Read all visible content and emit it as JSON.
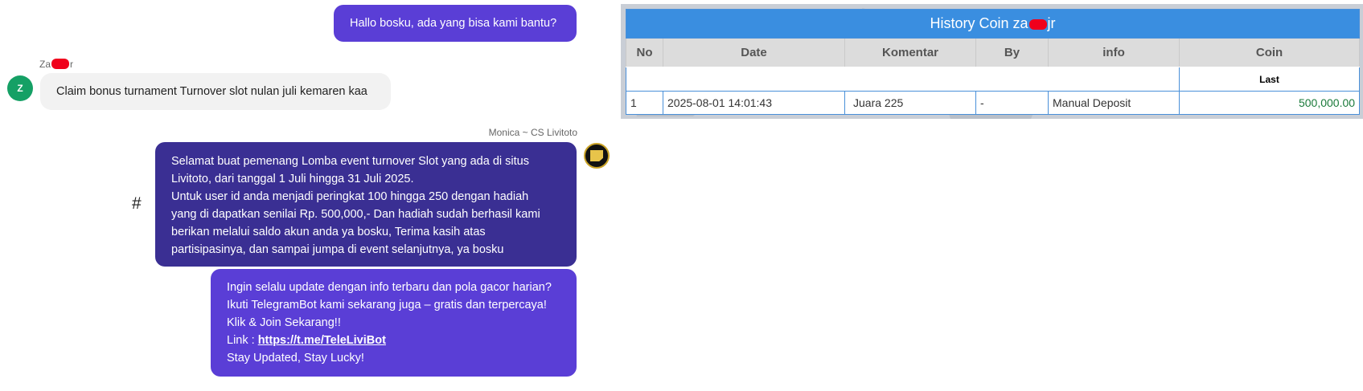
{
  "chat": {
    "greeting": "Hallo bosku, ada yang bisa kami bantu?",
    "user": {
      "name_prefix": "Za",
      "name_suffix": "r",
      "avatar_initial": "Z",
      "message": "Claim bonus turnament Turnover slot nulan juli kemaren kaa"
    },
    "agent": {
      "name": "Monica ~ CS Livitoto",
      "hash_symbol": "#",
      "message_lines": [
        "Selamat buat pemenang Lomba event turnover Slot yang ada di situs",
        "Livitoto, dari tanggal 1 Juli hingga 31 Juli 2025.",
        "Untuk user id anda menjadi peringkat 100 hingga 250 dengan hadiah",
        "yang di dapatkan senilai Rp. 500,000,- Dan hadiah sudah berhasil kami",
        "berikan melalui saldo akun anda ya bosku, Terima kasih atas",
        "partisipasinya, dan sampai jumpa di event selanjutnya, ya bosku"
      ]
    },
    "promo": {
      "line1": "Ingin selalu update dengan info terbaru dan pola gacor harian?",
      "line2": "Ikuti TelegramBot kami sekarang juga – gratis dan terpercaya!",
      "line3": "Klik & Join Sekarang!!",
      "link_label": "Link : ",
      "link_url": "https://t.me/TeleLiviBot",
      "line5": "Stay Updated, Stay Lucky!"
    }
  },
  "history": {
    "title_prefix": "History Coin za",
    "title_suffix": "jr",
    "columns": [
      "No",
      "Date",
      "Komentar",
      "By",
      "info",
      "Coin"
    ],
    "sub_label": "Last",
    "rows": [
      {
        "no": "1",
        "date": "2025-08-01 14:01:43",
        "komentar": "Juara 225",
        "by": "-",
        "info": "Manual Deposit",
        "coin": "500,000.00"
      }
    ]
  },
  "colors": {
    "bubble_purple": "#5a3ed6",
    "bubble_dark": "#3a2f93",
    "table_header_blue": "#3a8ee0",
    "coin_green": "#1a7a3a",
    "redaction": "#f0001c"
  }
}
